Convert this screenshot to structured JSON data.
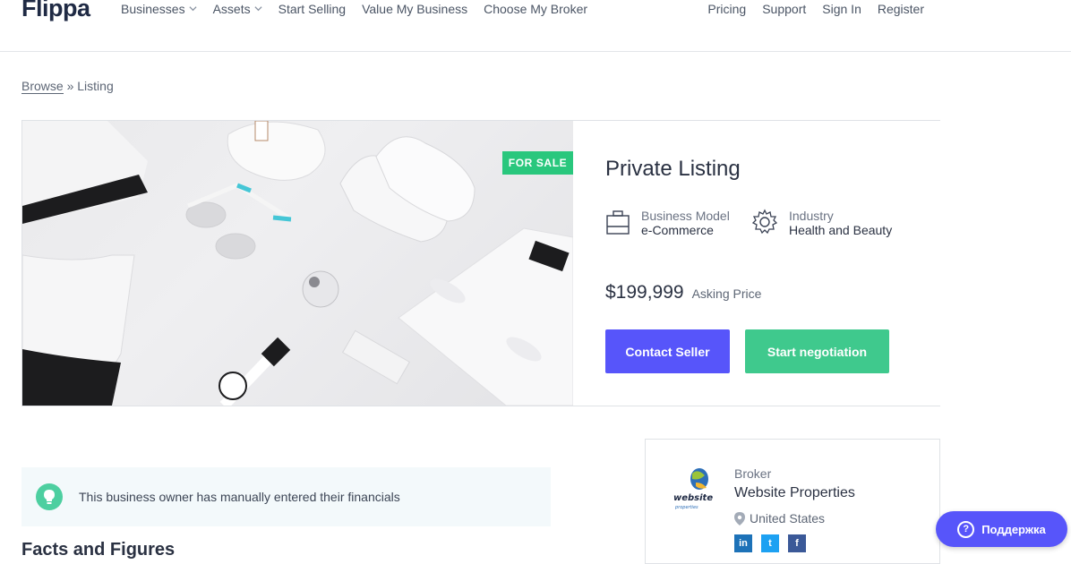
{
  "header": {
    "logo": "Flippa",
    "nav_left": [
      {
        "label": "Businesses",
        "dropdown": true
      },
      {
        "label": "Assets",
        "dropdown": true
      },
      {
        "label": "Start Selling"
      },
      {
        "label": "Value My Business"
      },
      {
        "label": "Choose My Broker"
      }
    ],
    "nav_right": [
      {
        "label": "Pricing"
      },
      {
        "label": "Support"
      },
      {
        "label": "Sign In"
      },
      {
        "label": "Register"
      }
    ]
  },
  "breadcrumb": {
    "browse": "Browse",
    "separator": "»",
    "current": "Listing"
  },
  "listing": {
    "badge": "FOR SALE",
    "title": "Private Listing",
    "business_model_label": "Business Model",
    "business_model_value": "e-Commerce",
    "industry_label": "Industry",
    "industry_value": "Health and Beauty",
    "price": "$199,999",
    "price_label": "Asking Price",
    "contact_button": "Contact Seller",
    "negotiate_button": "Start negotiation"
  },
  "notice": {
    "text": "This business owner has manually entered their financials"
  },
  "facts_heading": "Facts and Figures",
  "broker": {
    "label": "Broker",
    "name": "Website Properties",
    "location": "United States",
    "logo_text_1": "website",
    "logo_text_2": "properties",
    "social": [
      "in",
      "t",
      "f"
    ]
  },
  "support": {
    "label": "Поддержка"
  },
  "colors": {
    "primary": "#5755fa",
    "success": "#3fc98d",
    "badge": "#29c77d"
  }
}
